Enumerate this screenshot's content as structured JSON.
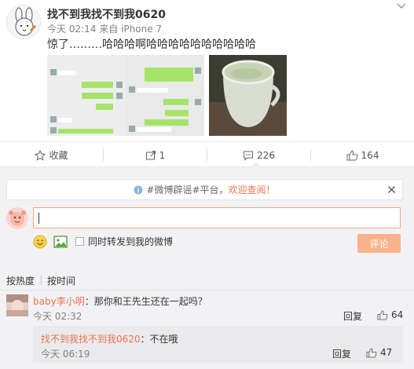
{
  "post": {
    "author": "找不到我找不到我0620",
    "time": "今天 02:14",
    "source_prefix": "来自",
    "source": "iPhone 7",
    "text": "惊了………哈哈哈啊哈哈哈哈哈哈哈哈哈哈",
    "images": [
      "chat-screenshot",
      "cup-of-water-photo"
    ]
  },
  "actions": {
    "favorite": "收藏",
    "repost_count": "1",
    "comment_count": "226",
    "like_count": "164"
  },
  "notice": {
    "prefix": "#微博辟谣#平台，",
    "highlight": "欢迎查阅！"
  },
  "composer": {
    "input_value": "",
    "repost_option": "同时转发到我的微博",
    "submit_label": "评论"
  },
  "sort": {
    "by_hot": "按热度",
    "by_time": "按时间"
  },
  "comments": [
    {
      "user": "baby李小明",
      "text": "：那你和王先生还在一起吗？",
      "time": "今天 02:32",
      "reply_label": "回复",
      "likes": "64",
      "replies": [
        {
          "user": "找不到我找不到我0620",
          "text": "：不在哦",
          "time": "今天 06:19",
          "reply_label": "回复",
          "likes": "47"
        }
      ]
    }
  ],
  "colors": {
    "accent": "#eb7350",
    "submit_bg": "#f8b38b",
    "input_border": "#f8a37a",
    "comment_bg": "#f2f2f5",
    "subcomment_bg": "#eaeaec"
  }
}
